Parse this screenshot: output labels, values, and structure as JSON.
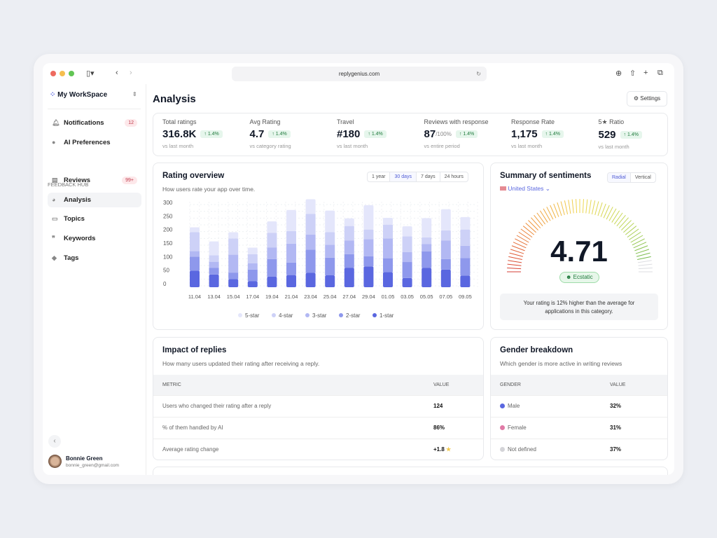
{
  "browser": {
    "url": "replygenius.com"
  },
  "sidebar": {
    "workspace": "My WorkSpace",
    "top_items": [
      {
        "label": "Notifications",
        "badge": "12"
      },
      {
        "label": "AI Preferences"
      }
    ],
    "section": "FEEDBACK HUB",
    "items": [
      {
        "label": "Reviews",
        "badge": "99+"
      },
      {
        "label": "Analysis"
      },
      {
        "label": "Topics"
      },
      {
        "label": "Keywords"
      },
      {
        "label": "Tags"
      }
    ],
    "user": {
      "name": "Bonnie Green",
      "email": "bonnie_green@gmail.com"
    }
  },
  "header": {
    "title": "Analysis",
    "settings": "Settings"
  },
  "stats": [
    {
      "label": "Total ratings",
      "value": "316.8K",
      "suffix": "",
      "change": "↑ 1.4%",
      "sub": "vs last month"
    },
    {
      "label": "Avg Rating",
      "value": "4.7",
      "suffix": "",
      "change": "↑ 1.4%",
      "sub": "vs category rating"
    },
    {
      "label": "Travel",
      "value": "#180",
      "suffix": "",
      "change": "↑ 1.4%",
      "sub": "vs last month"
    },
    {
      "label": "Reviews with response",
      "value": "87",
      "suffix": "/100%",
      "change": "↑ 1.4%",
      "sub": "vs entire period"
    },
    {
      "label": "Response Rate",
      "value": "1,175",
      "suffix": "",
      "change": "↑ 1.4%",
      "sub": "vs last month"
    },
    {
      "label": "5★ Ratio",
      "value": "529",
      "suffix": "",
      "change": "↑ 1.4%",
      "sub": "vs last month"
    }
  ],
  "rating_overview": {
    "title": "Rating overview",
    "subtitle": "How users rate your app over time.",
    "ranges": [
      "1 year",
      "30 days",
      "7 days",
      "24 hours"
    ],
    "selected_range": "30 days"
  },
  "chart_data": {
    "type": "bar",
    "stacked": true,
    "categories": [
      "11.04",
      "13.04",
      "15.04",
      "17.04",
      "19.04",
      "21.04",
      "23.04",
      "25.04",
      "27.04",
      "29.04",
      "01.05",
      "03.05",
      "05.05",
      "07.05",
      "09.05"
    ],
    "series": [
      {
        "name": "1-star",
        "color": "#5a67e0",
        "values": [
          61,
          47,
          30,
          22,
          39,
          45,
          53,
          44,
          72,
          77,
          56,
          34,
          71,
          65,
          43
        ]
      },
      {
        "name": "2-star",
        "color": "#8e98ec",
        "values": [
          52,
          25,
          24,
          43,
          65,
          46,
          86,
          65,
          50,
          37,
          51,
          59,
          61,
          39,
          65
        ]
      },
      {
        "name": "3-star",
        "color": "#b2b8f3",
        "values": [
          20,
          22,
          66,
          23,
          43,
          70,
          55,
          48,
          50,
          63,
          73,
          37,
          27,
          68,
          45
        ]
      },
      {
        "name": "4-star",
        "color": "#cdd1f7",
        "values": [
          70,
          24,
          60,
          34,
          54,
          46,
          77,
          46,
          54,
          36,
          51,
          58,
          25,
          38,
          60
        ]
      },
      {
        "name": "5-star",
        "color": "#e4e6fb",
        "values": [
          18,
          51,
          23,
          24,
          42,
          78,
          54,
          80,
          28,
          90,
          25,
          37,
          71,
          78,
          46
        ]
      }
    ],
    "yticks": [
      "0",
      "50",
      "100",
      "150",
      "200",
      "250",
      "300"
    ],
    "ylim": [
      0,
      300
    ],
    "legend": "bottom",
    "legend_order": [
      "5-star",
      "4-star",
      "3-star",
      "2-star",
      "1-star"
    ]
  },
  "sentiments": {
    "title": "Summary of sentiments",
    "views": [
      "Radial",
      "Vertical"
    ],
    "selected_view": "Radial",
    "country": "United States",
    "score": "4.71",
    "score_value": 4.71,
    "score_max": 5,
    "label": "Ecstatic",
    "note": "Your rating is 12% higher than the average for applications in this category."
  },
  "impact": {
    "title": "Impact of replies",
    "subtitle": "How many users updated their rating after receiving a reply.",
    "columns": [
      "METRIC",
      "VALUE"
    ],
    "rows": [
      [
        "Users who changed their rating after a reply",
        "124"
      ],
      [
        "% of them handled by AI",
        "86%"
      ],
      [
        "Average rating change",
        "+1.8"
      ]
    ]
  },
  "gender": {
    "title": "Gender breakdown",
    "subtitle": "Which gender is more active in writing reviews",
    "columns": [
      "GENDER",
      "VALUE"
    ],
    "rows": [
      {
        "label": "Male",
        "value": "32%",
        "color": "#5a67e0"
      },
      {
        "label": "Female",
        "value": "31%",
        "color": "#e07aa6"
      },
      {
        "label": "Not defined",
        "value": "37%",
        "color": "#d4d4d8"
      }
    ]
  }
}
